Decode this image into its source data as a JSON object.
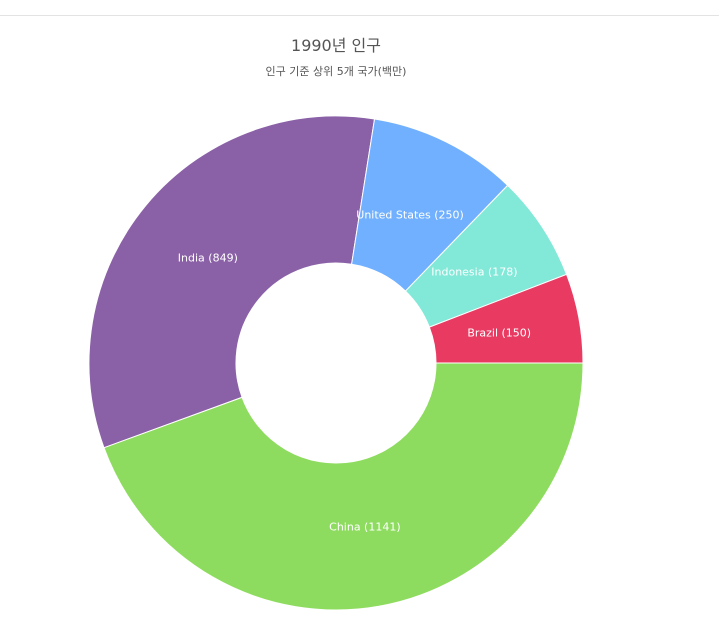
{
  "chart_data": {
    "type": "pie",
    "title": "1990년 인구",
    "subtitle": "인구 기준 상위 5개 국가(백만)",
    "donut": true,
    "slices": [
      {
        "label": "China (1141)",
        "name": "China",
        "value": 1141,
        "color": "#8edc5f"
      },
      {
        "label": "India (849)",
        "name": "India",
        "value": 849,
        "color": "#8a60a6"
      },
      {
        "label": "United States (250)",
        "name": "United States",
        "value": 250,
        "color": "#70b0ff"
      },
      {
        "label": "Indonesia (178)",
        "name": "Indonesia",
        "value": 178,
        "color": "#82e8d8"
      },
      {
        "label": "Brazil (150)",
        "name": "Brazil",
        "value": 150,
        "color": "#e93a62"
      }
    ]
  }
}
